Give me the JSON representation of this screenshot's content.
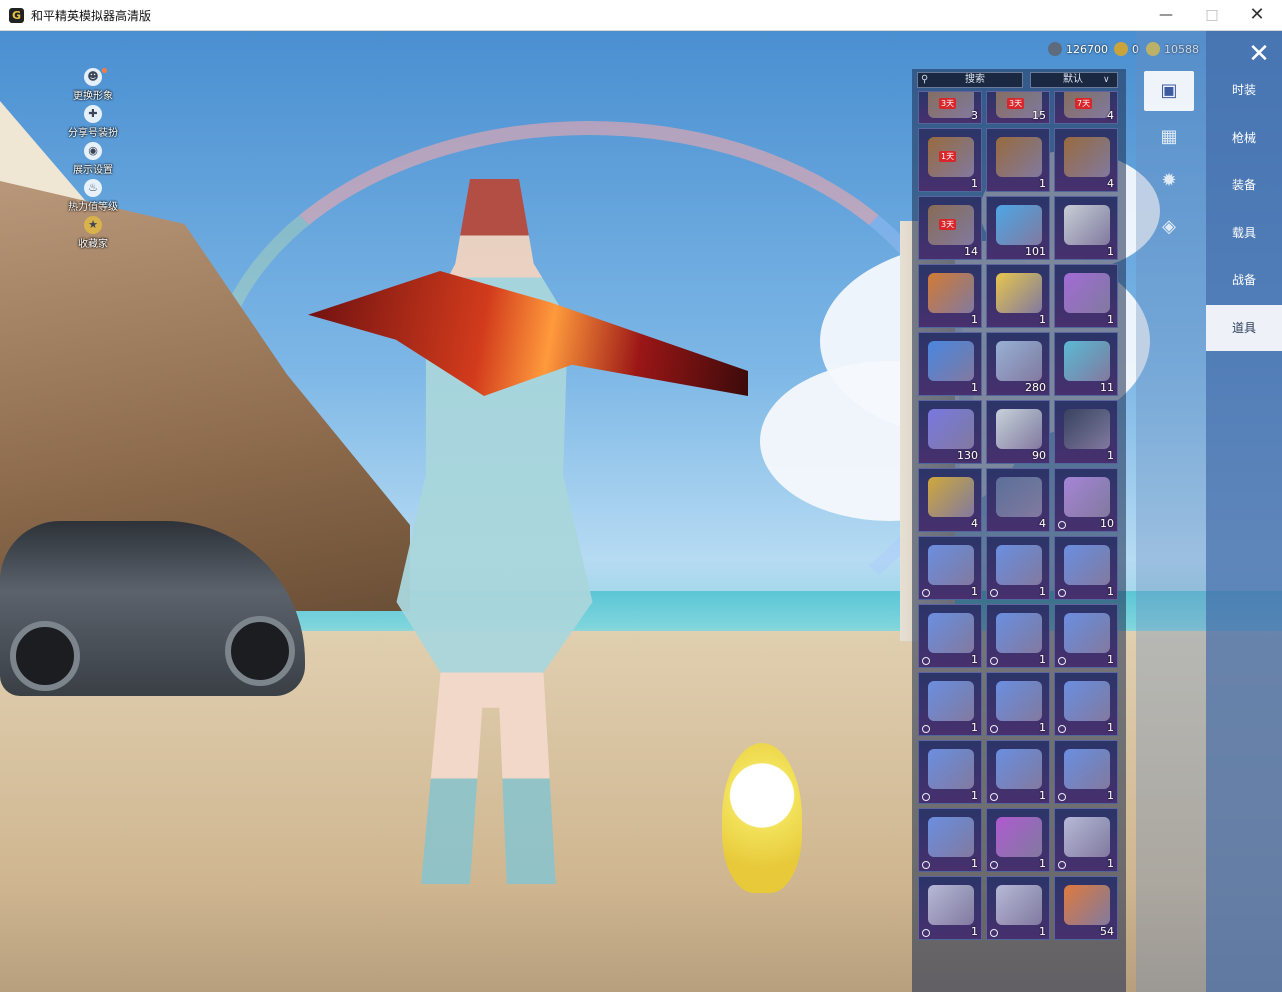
{
  "window": {
    "title": "和平精英模拟器高清版",
    "logo": "G"
  },
  "left_menu": [
    {
      "label": "更换形象",
      "icon": "avatar-icon"
    },
    {
      "label": "分享号装扮",
      "icon": "share-icon"
    },
    {
      "label": "展示设置",
      "icon": "eye-icon"
    },
    {
      "label": "热力值等级",
      "icon": "fire-icon"
    },
    {
      "label": "收藏家",
      "icon": "collector-icon"
    }
  ],
  "currency": [
    {
      "value": "126700",
      "color": "#5e6b7e"
    },
    {
      "value": "0",
      "color": "#c9a43c"
    },
    {
      "value": "10588",
      "color": "#e8c53d"
    }
  ],
  "inventory": {
    "search_placeholder": "搜索",
    "sort_label": "默认",
    "slots": [
      {
        "count": "3",
        "color": "#8a6b55",
        "badge": "3天"
      },
      {
        "count": "15",
        "color": "#8a6b55",
        "badge": "3天"
      },
      {
        "count": "4",
        "color": "#8a6b55",
        "badge": "7天"
      },
      {
        "count": "1",
        "color": "#9a6a3e",
        "badge": "1天"
      },
      {
        "count": "1",
        "color": "#9a6a3e",
        "badge": ""
      },
      {
        "count": "4",
        "color": "#9a6a3e",
        "badge": ""
      },
      {
        "count": "14",
        "color": "#8a6b55",
        "badge": "3天"
      },
      {
        "count": "101",
        "color": "#4fa6e6",
        "badge": ""
      },
      {
        "count": "1",
        "color": "#c9ced6",
        "badge": ""
      },
      {
        "count": "1",
        "color": "#d47a34",
        "badge": ""
      },
      {
        "count": "1",
        "color": "#e9c54d",
        "badge": ""
      },
      {
        "count": "1",
        "color": "#a46bd6",
        "badge": ""
      },
      {
        "count": "1",
        "color": "#4b86e0",
        "badge": ""
      },
      {
        "count": "280",
        "color": "#9ab0d6",
        "badge": ""
      },
      {
        "count": "11",
        "color": "#5cb9d4",
        "badge": ""
      },
      {
        "count": "130",
        "color": "#7a78e0",
        "badge": ""
      },
      {
        "count": "90",
        "color": "#c9d1da",
        "badge": ""
      },
      {
        "count": "1",
        "color": "#3a4260",
        "badge": ""
      },
      {
        "count": "4",
        "color": "#d1a83c",
        "badge": ""
      },
      {
        "count": "4",
        "color": "#5d6f9a",
        "badge": ""
      },
      {
        "count": "10",
        "color": "#a884d6",
        "badge": ""
      },
      {
        "count": "1",
        "color": "#6c8ee0",
        "badge": ""
      },
      {
        "count": "1",
        "color": "#6c8ee0",
        "badge": ""
      },
      {
        "count": "1",
        "color": "#6c8ee0",
        "badge": ""
      },
      {
        "count": "1",
        "color": "#6c8ee0",
        "badge": ""
      },
      {
        "count": "1",
        "color": "#6c8ee0",
        "badge": ""
      },
      {
        "count": "1",
        "color": "#6c8ee0",
        "badge": ""
      },
      {
        "count": "1",
        "color": "#6c8ee0",
        "badge": ""
      },
      {
        "count": "1",
        "color": "#6c8ee0",
        "badge": ""
      },
      {
        "count": "1",
        "color": "#6c8ee0",
        "badge": ""
      },
      {
        "count": "1",
        "color": "#6c8ee0",
        "badge": ""
      },
      {
        "count": "1",
        "color": "#6c8ee0",
        "badge": ""
      },
      {
        "count": "1",
        "color": "#6c8ee0",
        "badge": ""
      },
      {
        "count": "1",
        "color": "#6c8ee0",
        "badge": ""
      },
      {
        "count": "1",
        "color": "#b05ad0",
        "badge": ""
      },
      {
        "count": "1",
        "color": "#b8b8d8",
        "badge": ""
      },
      {
        "count": "1",
        "color": "#b8b8d8",
        "badge": ""
      },
      {
        "count": "1",
        "color": "#b8b8d8",
        "badge": ""
      },
      {
        "count": "54",
        "color": "#e07a3e",
        "badge": ""
      }
    ]
  },
  "side_icons": [
    "card-icon",
    "calendar-icon",
    "firework-icon",
    "ticket-icon"
  ],
  "tabs": [
    {
      "label": "时装",
      "active": false
    },
    {
      "label": "枪械",
      "active": false
    },
    {
      "label": "装备",
      "active": false
    },
    {
      "label": "载具",
      "active": false
    },
    {
      "label": "战备",
      "active": false
    },
    {
      "label": "道具",
      "active": true
    }
  ]
}
